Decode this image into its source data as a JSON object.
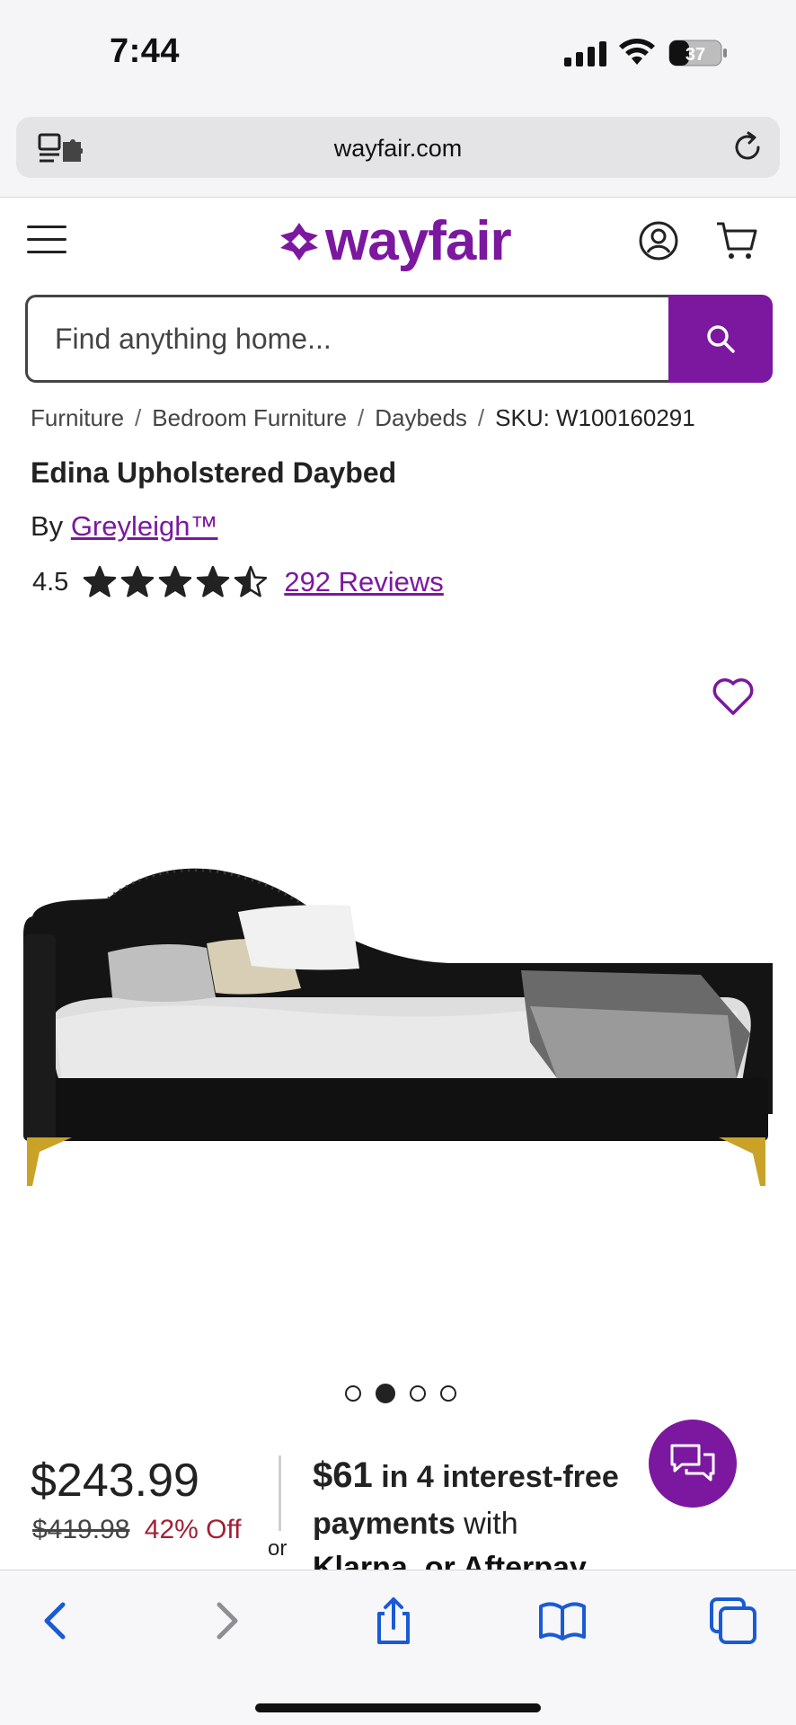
{
  "status_bar": {
    "time": "7:44",
    "battery": "37"
  },
  "browser": {
    "url": "wayfair.com"
  },
  "header": {
    "logo_text": "wayfair"
  },
  "search": {
    "placeholder": "Find anything home..."
  },
  "breadcrumb": {
    "items": [
      "Furniture",
      "Bedroom Furniture",
      "Daybeds"
    ],
    "separator": "/",
    "sku": "SKU: W100160291"
  },
  "product": {
    "title": "Edina Upholstered Daybed",
    "by_label": "By",
    "brand": "Greyleigh™",
    "rating": "4.5",
    "rating_value": 4.5,
    "rating_max": 5,
    "reviews_label": "292 Reviews",
    "image_count": 4,
    "active_image": 2
  },
  "pricing": {
    "price": "$243.99",
    "old_price": "$419.98",
    "discount": "42% Off",
    "or_label": "or",
    "installment_amount": "$61",
    "installment_text_bold": " in 4 interest-free payments",
    "installment_text_rest": " with",
    "klarna_peek": "Klarna. or  Afterpay"
  },
  "colors": {
    "brand_purple": "#7b189f",
    "discount_red": "#a41f35",
    "text": "#222222"
  },
  "icons": [
    "menu-icon",
    "account-icon",
    "cart-icon",
    "search-icon",
    "heart-icon",
    "chat-icon",
    "back-icon",
    "forward-icon",
    "share-icon",
    "bookmarks-icon",
    "tabs-icon",
    "reload-icon"
  ]
}
